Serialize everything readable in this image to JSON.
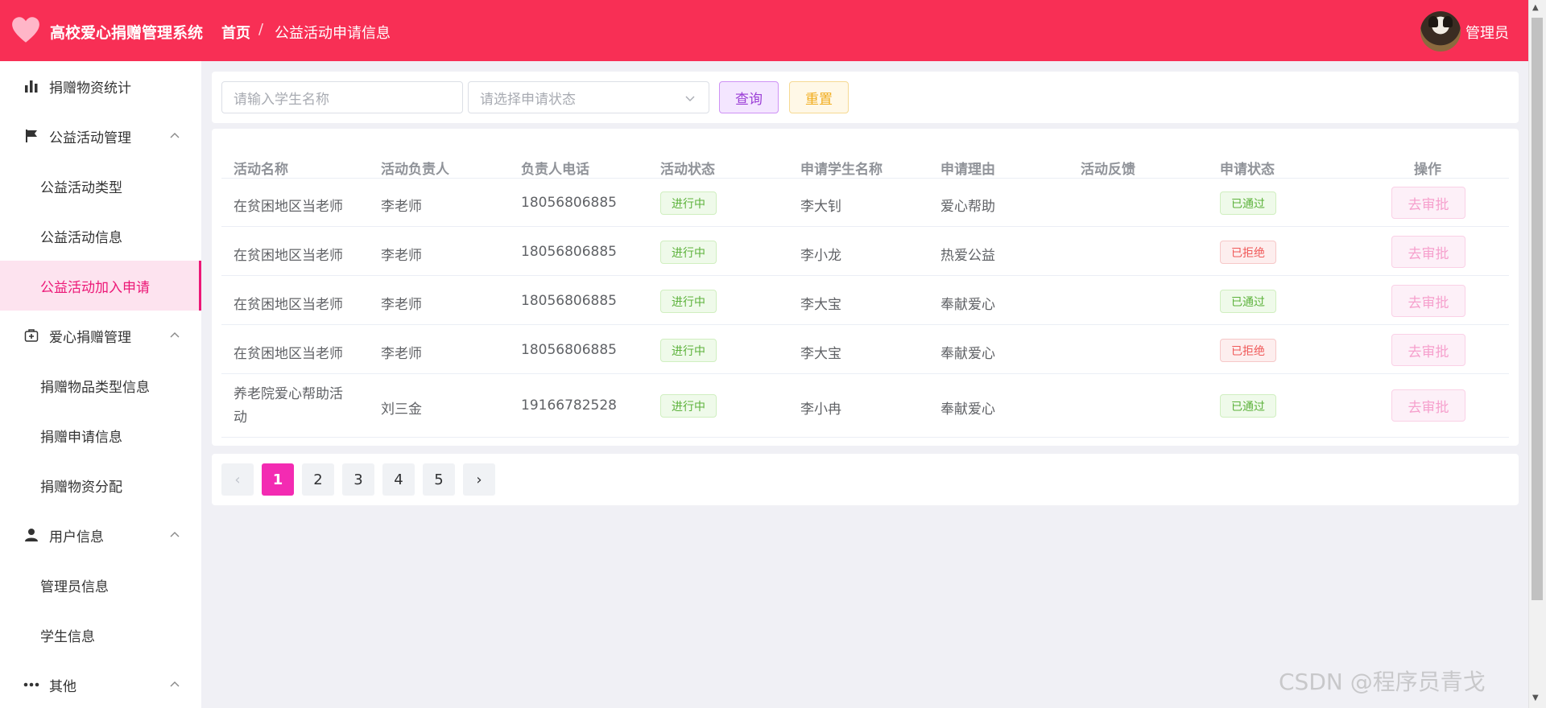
{
  "header": {
    "app_title": "高校爱心捐赠管理系统",
    "breadcrumb": {
      "home": "首页",
      "separator": "/",
      "current": "公益活动申请信息"
    },
    "user_name": "管理员",
    "bg_color": "#f82f55"
  },
  "sidebar": {
    "items": [
      {
        "type": "menu",
        "label": "捐赠物资统计",
        "icon": "bar-chart-icon"
      },
      {
        "type": "menu",
        "label": "公益活动管理",
        "icon": "flag-icon",
        "expanded": true
      },
      {
        "type": "sub",
        "label": "公益活动类型"
      },
      {
        "type": "sub",
        "label": "公益活动信息"
      },
      {
        "type": "sub",
        "label": "公益活动加入申请",
        "active": true
      },
      {
        "type": "menu",
        "label": "爱心捐赠管理",
        "icon": "medical-box-icon",
        "expanded": true
      },
      {
        "type": "sub",
        "label": "捐赠物品类型信息"
      },
      {
        "type": "sub",
        "label": "捐赠申请信息"
      },
      {
        "type": "sub",
        "label": "捐赠物资分配"
      },
      {
        "type": "menu",
        "label": "用户信息",
        "icon": "user-icon",
        "expanded": true
      },
      {
        "type": "sub",
        "label": "管理员信息"
      },
      {
        "type": "sub",
        "label": "学生信息"
      },
      {
        "type": "menu",
        "label": "其他",
        "icon": "more-dots-icon",
        "expanded": true
      }
    ]
  },
  "search": {
    "student_placeholder": "请输入学生名称",
    "status_placeholder": "请选择申请状态",
    "query_label": "查询",
    "reset_label": "重置"
  },
  "table": {
    "columns": [
      "活动名称",
      "活动负责人",
      "负责人电话",
      "活动状态",
      "申请学生名称",
      "申请理由",
      "活动反馈",
      "申请状态",
      "操作"
    ],
    "rows": [
      {
        "activity": "在贫困地区当老师",
        "leader": "李老师",
        "phone": "18056806885",
        "activity_status": "进行中",
        "student": "李大钊",
        "reason": "爱心帮助",
        "feedback": "",
        "apply_status": "已通过",
        "action": "去审批"
      },
      {
        "activity": "在贫困地区当老师",
        "leader": "李老师",
        "phone": "18056806885",
        "activity_status": "进行中",
        "student": "李小龙",
        "reason": "热爱公益",
        "feedback": "",
        "apply_status": "已拒绝",
        "action": "去审批"
      },
      {
        "activity": "在贫困地区当老师",
        "leader": "李老师",
        "phone": "18056806885",
        "activity_status": "进行中",
        "student": "李大宝",
        "reason": "奉献爱心",
        "feedback": "",
        "apply_status": "已通过",
        "action": "去审批"
      },
      {
        "activity": "在贫困地区当老师",
        "leader": "李老师",
        "phone": "18056806885",
        "activity_status": "进行中",
        "student": "李大宝",
        "reason": "奉献爱心",
        "feedback": "",
        "apply_status": "已拒绝",
        "action": "去审批"
      },
      {
        "activity": "养老院爱心帮助活动",
        "leader": "刘三金",
        "phone": "19166782528",
        "activity_status": "进行中",
        "student": "李小冉",
        "reason": "奉献爱心",
        "feedback": "",
        "apply_status": "已通过",
        "action": "去审批"
      }
    ]
  },
  "pagination": {
    "prev": "‹",
    "next": "›",
    "pages": [
      "1",
      "2",
      "3",
      "4",
      "5"
    ],
    "current": "1"
  },
  "watermark": "CSDN @程序员青戈"
}
